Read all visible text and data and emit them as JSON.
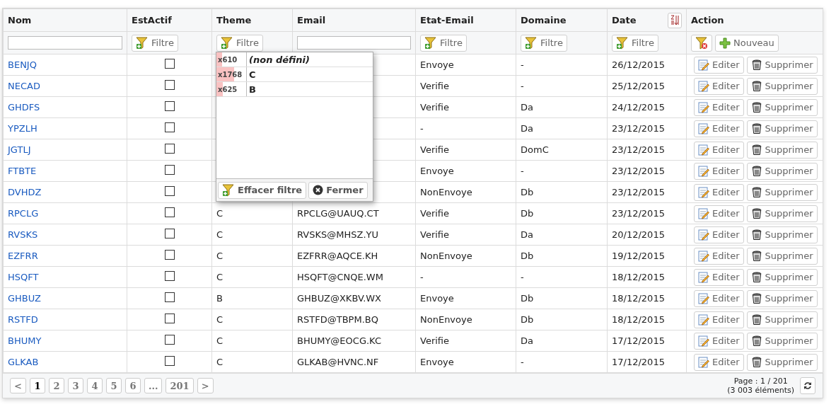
{
  "columns": [
    {
      "label": "Nom",
      "kind": "input",
      "sorted": false
    },
    {
      "label": "EstActif",
      "kind": "button",
      "filter": "Filtre",
      "sorted": false
    },
    {
      "label": "Theme",
      "kind": "button",
      "filter": "Filtre",
      "sorted": false
    },
    {
      "label": "Email",
      "kind": "input",
      "sorted": false
    },
    {
      "label": "Etat-Email",
      "kind": "button",
      "filter": "Filtre",
      "sorted": false
    },
    {
      "label": "Domaine",
      "kind": "button",
      "filter": "Filtre",
      "sorted": false
    },
    {
      "label": "Date",
      "kind": "button",
      "filter": "Filtre",
      "sorted": true
    },
    {
      "label": "Action",
      "kind": "actions",
      "new_label": "Nouveau",
      "sorted": false
    }
  ],
  "rows": [
    {
      "nom": "BENJQ",
      "checked": false,
      "etat": "Envoye",
      "domaine": "-",
      "date": "26/12/2015",
      "actions": [
        "Editer",
        "Supprimer"
      ]
    },
    {
      "nom": "NECAD",
      "checked": false,
      "etat": "Verifie",
      "domaine": "-",
      "date": "25/12/2015",
      "actions": [
        "Editer",
        "Supprimer"
      ]
    },
    {
      "nom": "GHDFS",
      "checked": false,
      "etat": "Verifie",
      "domaine": "Da",
      "date": "24/12/2015",
      "actions": [
        "Editer",
        "Supprimer"
      ]
    },
    {
      "nom": "YPZLH",
      "checked": false,
      "etat": "-",
      "domaine": "Da",
      "date": "23/12/2015",
      "actions": [
        "Editer",
        "Supprimer"
      ]
    },
    {
      "nom": "JGTLJ",
      "checked": false,
      "etat": "Verifie",
      "domaine": "DomC",
      "date": "23/12/2015",
      "actions": [
        "Editer",
        "Supprimer"
      ]
    },
    {
      "nom": "FTBTE",
      "checked": false,
      "etat": "Envoye",
      "domaine": "-",
      "date": "23/12/2015",
      "actions": [
        "Editer",
        "Supprimer"
      ]
    },
    {
      "nom": "DVHDZ",
      "checked": false,
      "etat": "NonEnvoye",
      "domaine": "Db",
      "date": "23/12/2015",
      "actions": [
        "Editer",
        "Supprimer"
      ]
    },
    {
      "nom": "RPCLG",
      "checked": false,
      "theme": "C",
      "email": "RPCLG@UAUQ.CT",
      "etat": "Verifie",
      "domaine": "Db",
      "date": "23/12/2015",
      "actions": [
        "Editer",
        "Supprimer"
      ]
    },
    {
      "nom": "RVSKS",
      "checked": false,
      "theme": "C",
      "email": "RVSKS@MHSZ.YU",
      "etat": "Verifie",
      "domaine": "Da",
      "date": "20/12/2015",
      "actions": [
        "Editer",
        "Supprimer"
      ]
    },
    {
      "nom": "EZFRR",
      "checked": false,
      "theme": "C",
      "email": "EZFRR@AQCE.KH",
      "etat": "NonEnvoye",
      "domaine": "Db",
      "date": "19/12/2015",
      "actions": [
        "Editer",
        "Supprimer"
      ]
    },
    {
      "nom": "HSQFT",
      "checked": false,
      "theme": "C",
      "email": "HSQFT@CNQE.WM",
      "etat": "-",
      "domaine": "-",
      "date": "18/12/2015",
      "actions": [
        "Editer",
        "Supprimer"
      ]
    },
    {
      "nom": "GHBUZ",
      "checked": false,
      "theme": "B",
      "email": "GHBUZ@XKBV.WX",
      "etat": "Envoye",
      "domaine": "Db",
      "date": "18/12/2015",
      "actions": [
        "Editer",
        "Supprimer"
      ]
    },
    {
      "nom": "RSTFD",
      "checked": false,
      "theme": "C",
      "email": "RSTFD@TBPM.BQ",
      "etat": "NonEnvoye",
      "domaine": "Db",
      "date": "18/12/2015",
      "actions": [
        "Editer",
        "Supprimer"
      ]
    },
    {
      "nom": "BHUMY",
      "checked": false,
      "theme": "C",
      "email": "BHUMY@EOCG.KC",
      "etat": "Verifie",
      "domaine": "Da",
      "date": "17/12/2015",
      "actions": [
        "Editer",
        "Supprimer"
      ]
    },
    {
      "nom": "GLKAB",
      "checked": false,
      "theme": "C",
      "email": "GLKAB@HVNC.NF",
      "etat": "Envoye",
      "domaine": "-",
      "date": "17/12/2015",
      "actions": [
        "Editer",
        "Supprimer"
      ]
    }
  ],
  "filter_popup": {
    "items": [
      {
        "count": "x610",
        "label": "(non défini)",
        "kind": "undefined",
        "level": 0.2
      },
      {
        "count": "x1768",
        "label": "C",
        "kind": "value",
        "level": 0.59
      },
      {
        "count": "x625",
        "label": "B",
        "kind": "value",
        "level": 0.21
      }
    ],
    "clear_label": "Effacer filtre",
    "close_label": "Fermer"
  },
  "pager": {
    "prev": "<",
    "next": ">",
    "pages": [
      {
        "label": "1",
        "selected": true
      },
      {
        "label": "2",
        "selected": false
      },
      {
        "label": "3",
        "selected": false
      },
      {
        "label": "4",
        "selected": false
      },
      {
        "label": "5",
        "selected": false
      },
      {
        "label": "6",
        "selected": false
      },
      {
        "label": "...",
        "selected": false
      },
      {
        "label": "201",
        "selected": false
      }
    ],
    "page_info": "Page : 1 / 201",
    "count_info": "(3 003 éléments)"
  }
}
